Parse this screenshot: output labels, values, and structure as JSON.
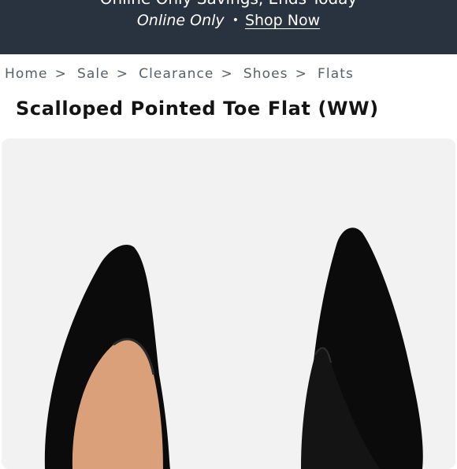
{
  "promo": {
    "headline": "Online Only Savings, Ends Today",
    "channel": "Online Only",
    "separator": "•",
    "cta": "Shop Now"
  },
  "breadcrumb": {
    "items": [
      "Home",
      "Sale",
      "Clearance",
      "Shoes",
      "Flats"
    ],
    "separator": ">"
  },
  "product": {
    "title": "Scalloped Pointed Toe Flat (WW)"
  },
  "colors": {
    "banner": "#29333f",
    "shoe": "#0b0b0b",
    "lining": "#d9a07a",
    "background": "#f2f2f2"
  }
}
